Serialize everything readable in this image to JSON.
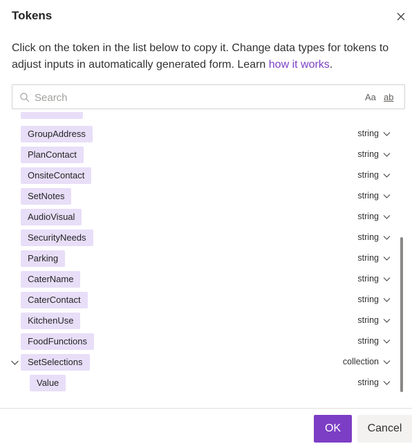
{
  "dialog": {
    "title": "Tokens",
    "description_text": "Click on the token in the list below to copy it. Change data types for tokens to adjust inputs in automatically generated form. Learn ",
    "description_link": "how it works",
    "description_end": "."
  },
  "search": {
    "placeholder": "Search",
    "value": "",
    "match_case_label": "Aa",
    "whole_word_label": "ab"
  },
  "tokens": [
    {
      "name": "GroupAddress",
      "type": "string"
    },
    {
      "name": "PlanContact",
      "type": "string"
    },
    {
      "name": "OnsiteContact",
      "type": "string"
    },
    {
      "name": "SetNotes",
      "type": "string"
    },
    {
      "name": "AudioVisual",
      "type": "string"
    },
    {
      "name": "SecurityNeeds",
      "type": "string"
    },
    {
      "name": "Parking",
      "type": "string"
    },
    {
      "name": "CaterName",
      "type": "string"
    },
    {
      "name": "CaterContact",
      "type": "string"
    },
    {
      "name": "KitchenUse",
      "type": "string"
    },
    {
      "name": "FoodFunctions",
      "type": "string"
    },
    {
      "name": "SetSelections",
      "type": "collection",
      "expanded": true
    },
    {
      "name": "Value",
      "type": "string",
      "nested": true
    }
  ],
  "footer": {
    "ok_label": "OK",
    "cancel_label": "Cancel"
  },
  "colors": {
    "accent": "#7c3ec4",
    "chip_bg": "#e8def8"
  }
}
